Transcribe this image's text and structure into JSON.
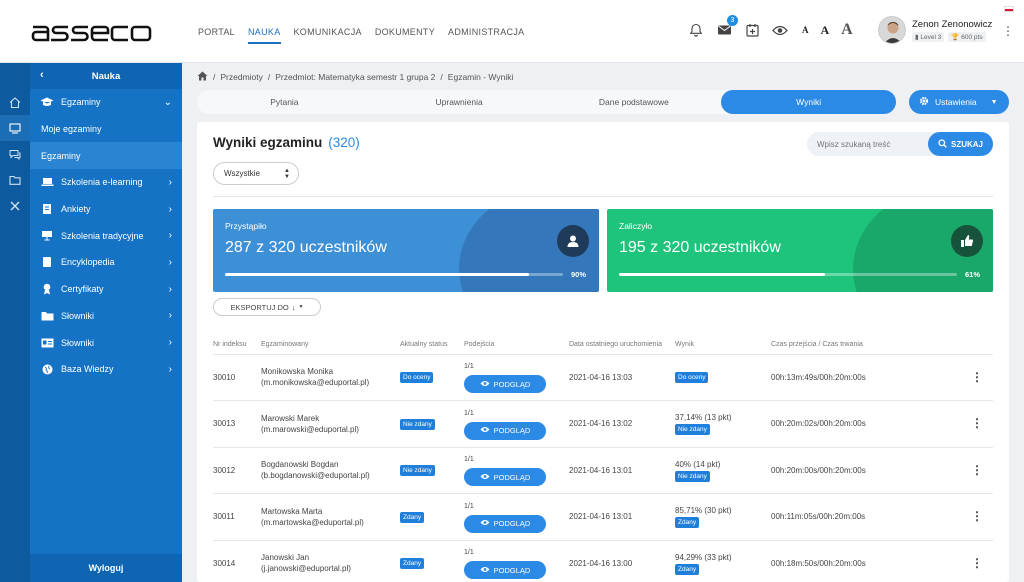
{
  "brand": "asseco",
  "topnav": [
    "PORTAL",
    "NAUKA",
    "KOMUNIKACJA",
    "DOKUMENTY",
    "ADMINISTRACJA"
  ],
  "topnav_active": 1,
  "messages_badge": "3",
  "font_sizes": [
    "A",
    "A",
    "A"
  ],
  "user": {
    "name": "Zenon Zenonowicz",
    "level": "Level 3",
    "points": "600 pts"
  },
  "sidebar": {
    "header": "Nauka",
    "items": [
      {
        "label": "Egzaminy",
        "icon": "graduation-cap-icon",
        "chevron": "down"
      },
      {
        "label": "Moje egzaminy",
        "sub": true
      },
      {
        "label": "Egzaminy",
        "sub": true,
        "selected": true
      },
      {
        "label": "Szkolenia e-learning",
        "icon": "laptop-icon",
        "chevron": "right"
      },
      {
        "label": "Ankiety",
        "icon": "survey-icon",
        "chevron": "right"
      },
      {
        "label": "Szkolenia tradycyjne",
        "icon": "presentation-icon",
        "chevron": "right"
      },
      {
        "label": "Encyklopedia",
        "icon": "book-icon",
        "chevron": "right"
      },
      {
        "label": "Certyfikaty",
        "icon": "certificate-icon",
        "chevron": "right"
      },
      {
        "label": "Słowniki",
        "icon": "folder-icon",
        "chevron": "right"
      },
      {
        "label": "Słowniki",
        "icon": "id-card-icon",
        "chevron": "right"
      },
      {
        "label": "Baza Wiedzy",
        "icon": "globe-icon",
        "chevron": "right"
      }
    ],
    "logout": "Wyloguj"
  },
  "breadcrumb": [
    "Przedmioty",
    "Przedmiot: Matematyka semestr 1 grupa 2",
    "Egzamin - Wyniki"
  ],
  "tabs": [
    "Pytania",
    "Uprawnienia",
    "Dane podstawowe",
    "Wyniki"
  ],
  "tabs_active": 3,
  "settings_label": "Ustawienia",
  "page": {
    "title": "Wyniki egzaminu",
    "count": "(320)",
    "search_placeholder": "Wpisz szukaną treść",
    "search_button": "SZUKAJ",
    "filter_value": "Wszystkie",
    "export_label": "EKSPORTUJ DO"
  },
  "stats": [
    {
      "label": "Przystąpiło",
      "value": "287 z 320 uczestników",
      "percent_label": "90%",
      "fraction": 0.9,
      "color": "#3d8fd6",
      "icon": "user-icon"
    },
    {
      "label": "Zaliczyło",
      "value": "195 z 320 uczestników",
      "percent_label": "61%",
      "fraction": 0.61,
      "color": "#1ec47b",
      "icon": "thumbs-up-icon"
    }
  ],
  "table": {
    "headers": [
      "Nr indeksu",
      "Egzaminowany",
      "Aktualny status",
      "Podejścia",
      "Data ostatniego uruchomienia",
      "Wynik",
      "Czas przejścia / Czas trwania"
    ],
    "preview_label": "PODGLĄD",
    "rows": [
      {
        "index": "30010",
        "name": "Monikowska Monika",
        "email": "(m.monikowska@eduportal.pl)",
        "status": "Do oceny",
        "attempts": "1/1",
        "date": "2021-04-16 13:03",
        "result_text": "",
        "result_badge": "Do oceny",
        "time": "00h:13m:49s/00h:20m:00s"
      },
      {
        "index": "30013",
        "name": "Marowski Marek",
        "email": "(m.marowski@eduportal.pl)",
        "status": "Nie zdany",
        "attempts": "1/1",
        "date": "2021-04-16 13:02",
        "result_text": "37,14% (13 pkt)",
        "result_badge": "Nie zdany",
        "time": "00h:20m:02s/00h:20m:00s"
      },
      {
        "index": "30012",
        "name": "Bogdanowski Bogdan",
        "email": "(b.bogdanowski@eduportal.pl)",
        "status": "Nie zdany",
        "attempts": "1/1",
        "date": "2021-04-16 13:01",
        "result_text": "40% (14 pkt)",
        "result_badge": "Nie zdany",
        "time": "00h:20m:00s/00h:20m:00s"
      },
      {
        "index": "30011",
        "name": "Martowska Marta",
        "email": "(m.martowska@eduportal.pl)",
        "status": "Zdany",
        "attempts": "1/1",
        "date": "2021-04-16 13:01",
        "result_text": "85,71% (30 pkt)",
        "result_badge": "Zdany",
        "time": "00h:11m:05s/00h:20m:00s"
      },
      {
        "index": "30014",
        "name": "Janowski Jan",
        "email": "(j.janowski@eduportal.pl)",
        "status": "Zdany",
        "attempts": "1/1",
        "date": "2021-04-16 13:00",
        "result_text": "94,29% (33 pkt)",
        "result_badge": "Zdany",
        "time": "00h:18m:50s/00h:20m:00s"
      }
    ]
  }
}
